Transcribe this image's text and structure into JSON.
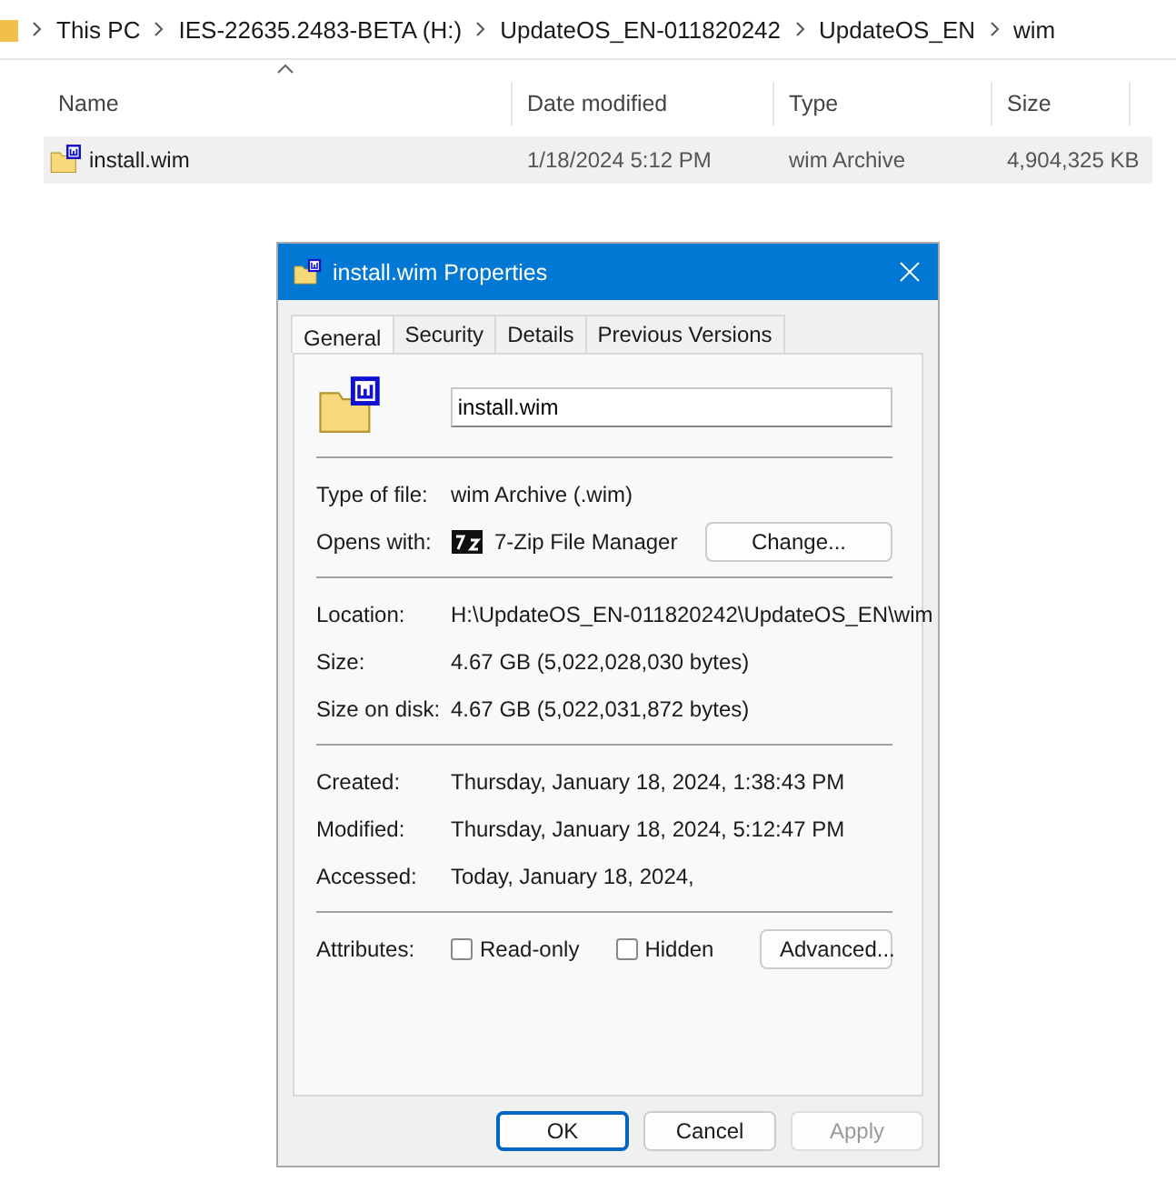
{
  "breadcrumb": [
    "This PC",
    "IES-22635.2483-BETA (H:)",
    "UpdateOS_EN-011820242",
    "UpdateOS_EN",
    "wim"
  ],
  "columns": [
    "Name",
    "Date modified",
    "Type",
    "Size"
  ],
  "files": [
    {
      "name": "install.wim",
      "date": "1/18/2024 5:12 PM",
      "type": "wim Archive",
      "size": "4,904,325 KB",
      "selected": true
    }
  ],
  "dialog": {
    "title": "install.wim Properties",
    "tabs": [
      {
        "label": "General",
        "selected": true
      },
      {
        "label": "Security",
        "selected": false
      },
      {
        "label": "Details",
        "selected": false
      },
      {
        "label": "Previous Versions",
        "selected": false
      }
    ],
    "filename": "install.wim",
    "sections": [
      [
        {
          "kind": "text",
          "label": "Type of file:",
          "value": "wim Archive (.wim)"
        },
        {
          "kind": "app",
          "label": "Opens with:",
          "value": "7-Zip File Manager",
          "button": "Change..."
        }
      ],
      [
        {
          "kind": "text",
          "label": "Location:",
          "value": "H:\\UpdateOS_EN-011820242\\UpdateOS_EN\\wim"
        },
        {
          "kind": "text",
          "label": "Size:",
          "value": "4.67 GB (5,022,028,030 bytes)"
        },
        {
          "kind": "text",
          "label": "Size on disk:",
          "value": "4.67 GB (5,022,031,872 bytes)"
        }
      ],
      [
        {
          "kind": "text",
          "label": "Created:",
          "value": "Thursday, January 18, 2024, 1:38:43 PM"
        },
        {
          "kind": "text",
          "label": "Modified:",
          "value": "Thursday, January 18, 2024, 5:12:47 PM"
        },
        {
          "kind": "text",
          "label": "Accessed:",
          "value": "Today, January 18, 2024,"
        }
      ],
      [
        {
          "kind": "attributes",
          "label": "Attributes:",
          "checkboxes": [
            {
              "label": "Read-only",
              "checked": false
            },
            {
              "label": "Hidden",
              "checked": false
            }
          ],
          "button": "Advanced..."
        }
      ]
    ],
    "buttons": [
      {
        "label": "OK",
        "default": true,
        "disabled": false
      },
      {
        "label": "Cancel",
        "default": false,
        "disabled": false
      },
      {
        "label": "Apply",
        "default": false,
        "disabled": true
      }
    ]
  }
}
